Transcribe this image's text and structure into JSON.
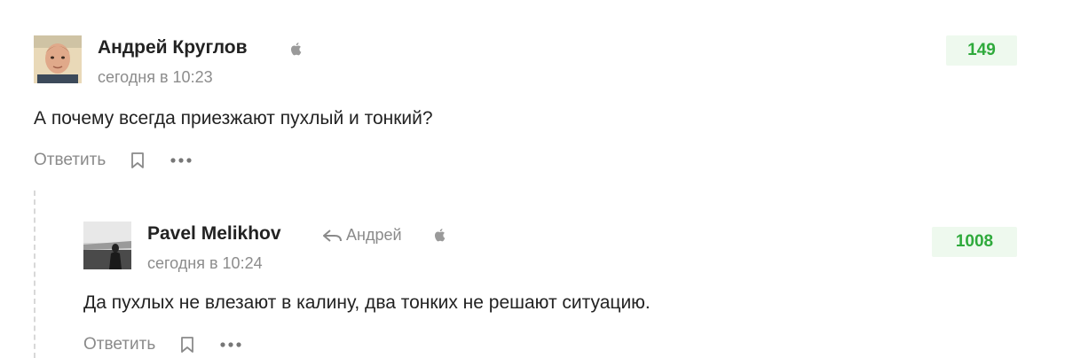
{
  "comments": [
    {
      "author": "Андрей Круглов",
      "time": "сегодня в 10:23",
      "rating": "149",
      "text": "А почему всегда приезжают пухлый и тонкий?",
      "reply_label": "Ответить",
      "platform_icon": "apple-icon"
    },
    {
      "author": "Pavel Melikhov",
      "reply_to": "Андрей",
      "time": "сегодня в 10:24",
      "rating": "1008",
      "text": "Да пухлых не влезают в калину, два тонких не решают ситуацию.",
      "reply_label": "Ответить",
      "platform_icon": "apple-icon"
    }
  ],
  "colors": {
    "rating_text": "#2faa3c",
    "rating_bg": "#eef9ee",
    "muted_text": "#8a8a8a",
    "thread_line": "#d8d8d8"
  },
  "icons": [
    "apple-icon",
    "reply-arrow-icon",
    "bookmark-icon",
    "more-icon"
  ]
}
